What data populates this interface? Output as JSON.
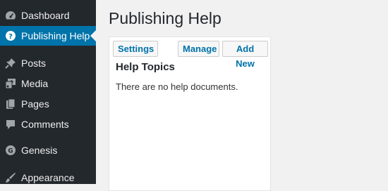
{
  "sidebar": {
    "items": [
      {
        "label": "Dashboard",
        "icon": "dashboard-icon"
      },
      {
        "label": "Publishing Help",
        "icon": "help-icon",
        "active": true
      },
      {
        "label": "Posts",
        "icon": "pin-icon"
      },
      {
        "label": "Media",
        "icon": "media-icon"
      },
      {
        "label": "Pages",
        "icon": "pages-icon"
      },
      {
        "label": "Comments",
        "icon": "comment-icon"
      },
      {
        "label": "Genesis",
        "icon": "genesis-icon"
      },
      {
        "label": "Appearance",
        "icon": "brush-icon"
      }
    ]
  },
  "page": {
    "title": "Publishing Help"
  },
  "panel": {
    "buttons": {
      "settings": "Settings",
      "manage": "Manage",
      "add_new": "Add New"
    },
    "heading": "Help Topics",
    "empty_text": "There are no help documents."
  },
  "colors": {
    "sidebar_bg": "#23282d",
    "active_bg": "#0073aa",
    "link": "#0073aa",
    "page_bg": "#f1f1f1"
  }
}
